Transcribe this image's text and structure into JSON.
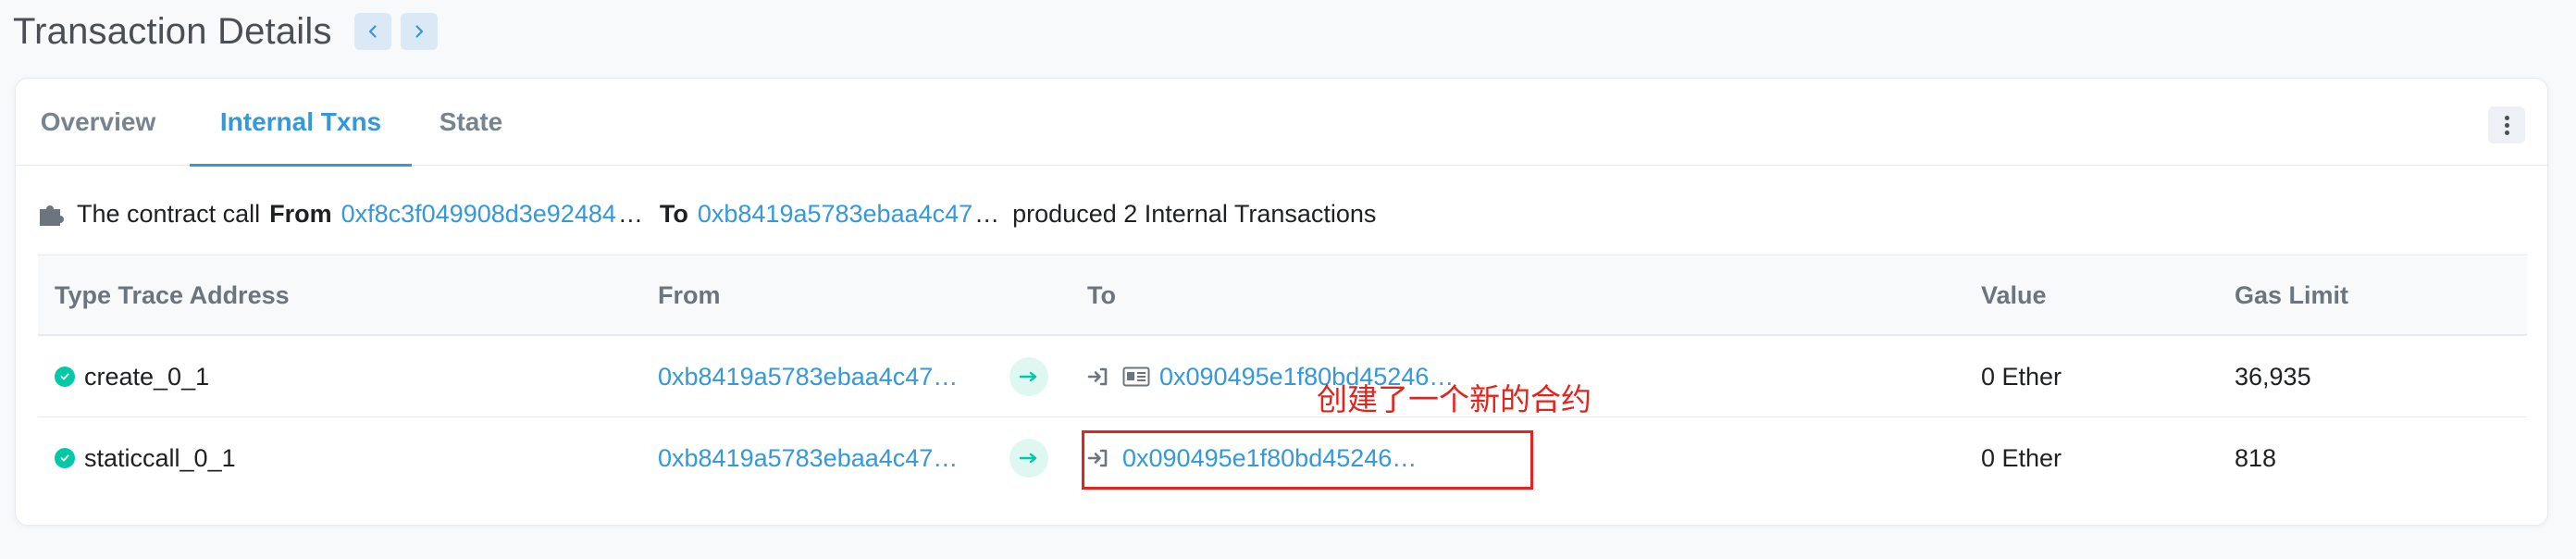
{
  "header": {
    "title": "Transaction Details"
  },
  "tabs": [
    {
      "label": "Overview"
    },
    {
      "label": "Internal Txns"
    },
    {
      "label": "State"
    }
  ],
  "summary": {
    "prefix": "The contract call",
    "from_label": "From",
    "from_address": "0xf8c3f049908d3e92484",
    "to_label": "To",
    "to_address": "0xb8419a5783ebaa4c47",
    "ellipsis": "…",
    "suffix": "produced 2 Internal Transactions"
  },
  "table": {
    "columns": [
      "Type Trace Address",
      "From",
      "To",
      "Value",
      "Gas Limit"
    ],
    "rows": [
      {
        "type": "create_0_1",
        "from": "0xb8419a5783ebaa4c47…",
        "to": "0x090495e1f80bd45246…",
        "to_is_contract": true,
        "value": "0 Ether",
        "gas_limit": "36,935"
      },
      {
        "type": "staticcall_0_1",
        "from": "0xb8419a5783ebaa4c47…",
        "to": "0x090495e1f80bd45246…",
        "to_is_contract": false,
        "value": "0 Ether",
        "gas_limit": "818"
      }
    ]
  },
  "annotation": {
    "text": "创建了一个新的合约",
    "color": "#e5231d"
  },
  "colors": {
    "accent": "#3498db",
    "success": "#00c9a7",
    "muted": "#77838f"
  }
}
